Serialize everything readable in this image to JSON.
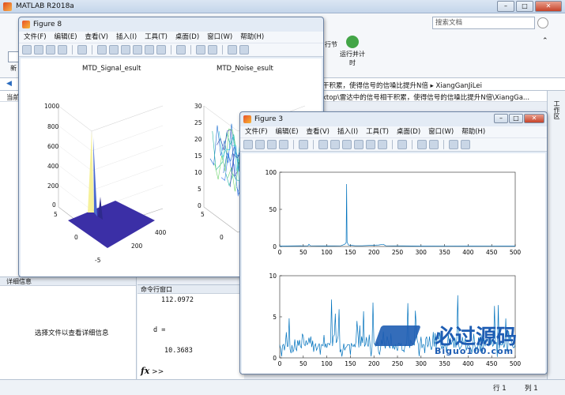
{
  "app": {
    "title": "MATLAB R2018a"
  },
  "search": {
    "placeholder": "搜索文档"
  },
  "ribbon": {
    "tab_hint": "",
    "new_label": "新",
    "run_section_label": "行节",
    "run_timer_label": "运行并计时"
  },
  "address": {
    "path_text": "干积累，使得信号的信噪比提升N倍 ▸ XiangGanJiLei",
    "path_full": "ktop\\雷达中的信号相干积累，使得信号的信噪比提升N倍\\XiangGa...",
    "left_label": "当前"
  },
  "right_strip": {
    "label": "工作区"
  },
  "detail_pane": {
    "header": "详细信息",
    "message": "选择文件以查看详细信息"
  },
  "command_window": {
    "header": "命令行窗口",
    "lines": [
      "112.0972",
      "d =",
      "10.3683"
    ],
    "prompt": "fx >>"
  },
  "status": {
    "row": "行 1",
    "col": "列 1"
  },
  "figure8": {
    "title": "Figure 8",
    "menu": [
      "文件(F)",
      "编辑(E)",
      "查看(V)",
      "插入(I)",
      "工具(T)",
      "桌面(D)",
      "窗口(W)",
      "帮助(H)"
    ],
    "plot1": {
      "title": "MTD_Signal_esult",
      "z_ticks": [
        "1000",
        "800",
        "600",
        "400",
        "200",
        "0"
      ],
      "y_ticks": [
        "5",
        "0",
        "-5"
      ],
      "x_ticks": [
        "200",
        "400"
      ]
    },
    "plot2": {
      "title": "MTD_Noise_esult",
      "z_ticks": [
        "30",
        "25",
        "20",
        "15",
        "10",
        "5",
        "0"
      ],
      "y_ticks": [
        "5",
        "0",
        "-5"
      ]
    }
  },
  "figure3": {
    "title": "Figure 3",
    "menu": [
      "文件(F)",
      "编辑(E)",
      "查看(V)",
      "插入(I)",
      "工具(T)",
      "桌面(D)",
      "窗口(W)",
      "帮助(H)"
    ]
  },
  "chart_data": [
    {
      "type": "line",
      "title": "",
      "xlabel": "",
      "ylabel": "",
      "xlim": [
        0,
        500
      ],
      "ylim": [
        0,
        100
      ],
      "x_ticks": [
        0,
        50,
        100,
        150,
        200,
        250,
        300,
        350,
        400,
        450,
        500
      ],
      "y_ticks": [
        0,
        50,
        100
      ],
      "series": [
        {
          "color": "#0072bd",
          "points": [
            [
              0,
              0.5
            ],
            [
              60,
              1
            ],
            [
              62,
              3
            ],
            [
              65,
              1
            ],
            [
              100,
              0.8
            ],
            [
              130,
              1
            ],
            [
              138,
              3
            ],
            [
              141,
              5
            ],
            [
              142,
              84
            ],
            [
              143,
              6
            ],
            [
              146,
              2
            ],
            [
              160,
              1
            ],
            [
              175,
              1
            ],
            [
              210,
              2
            ],
            [
              220,
              3
            ],
            [
              225,
              1
            ],
            [
              260,
              0.8
            ],
            [
              300,
              0.5
            ],
            [
              350,
              0.6
            ],
            [
              400,
              0.5
            ],
            [
              450,
              0.6
            ],
            [
              500,
              0.5
            ]
          ]
        }
      ]
    },
    {
      "type": "line",
      "title": "",
      "xlabel": "",
      "ylabel": "",
      "xlim": [
        0,
        500
      ],
      "ylim": [
        0,
        10
      ],
      "x_ticks": [
        0,
        50,
        100,
        150,
        200,
        250,
        300,
        350,
        400,
        450,
        500
      ],
      "y_ticks": [
        0,
        5,
        10
      ],
      "series": [
        {
          "color": "#0072bd",
          "noise": true,
          "mean": 1.6,
          "peak_max": 7.7
        }
      ]
    }
  ],
  "watermark": {
    "cn": "必过源码",
    "url": "Biguo100.com"
  },
  "colors": {
    "accent": "#0072bd",
    "surface_3d": "#3b2fa6",
    "figure_bg": "#e3ebf5"
  }
}
